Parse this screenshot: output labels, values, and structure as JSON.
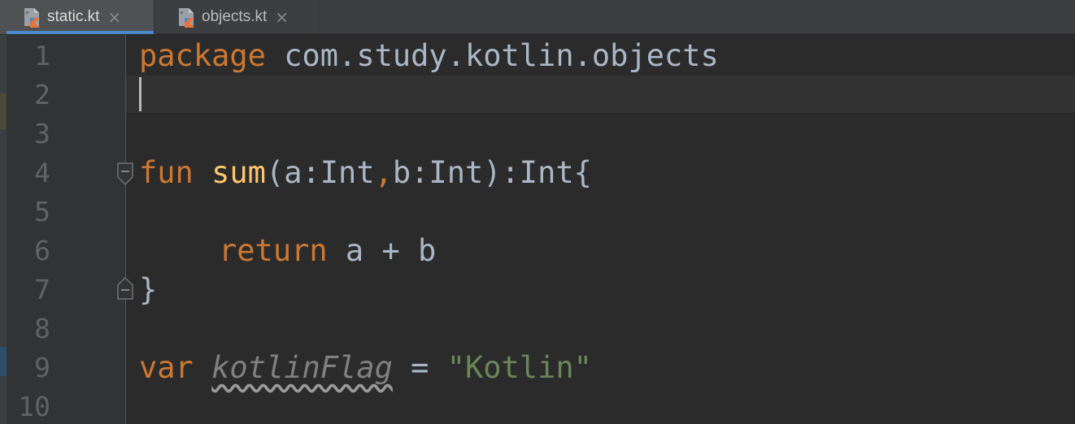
{
  "tabs": [
    {
      "label": "static.kt",
      "close": "×",
      "active": true,
      "icon": "kotlin-file-icon"
    },
    {
      "label": "objects.kt",
      "close": "×",
      "active": false,
      "icon": "kotlin-file-icon"
    }
  ],
  "editor": {
    "line_numbers": [
      "1",
      "2",
      "3",
      "4",
      "5",
      "6",
      "7",
      "8",
      "9",
      "10"
    ],
    "code": {
      "l1_kw": "package",
      "l1_pkg": " com.study.kotlin.objects",
      "l4_kw": "fun",
      "l4_name": "sum",
      "l4_a": "(a:Int",
      "l4_comma": ",",
      "l4_b": "b:Int):Int{",
      "l6_kw": "return",
      "l6_expr": " a + b",
      "l7_brace": "}",
      "l9_kw": "var",
      "l9_name": "kotlinFlag",
      "l9_eq": " = ",
      "l9_str": "\"Kotlin\""
    },
    "colors": {
      "keyword": "#cc7832",
      "function": "#ffc66d",
      "string": "#6a8759",
      "text": "#a9b7c6",
      "background": "#2b2b2b",
      "tab_active_underline": "#4a88c7"
    }
  }
}
